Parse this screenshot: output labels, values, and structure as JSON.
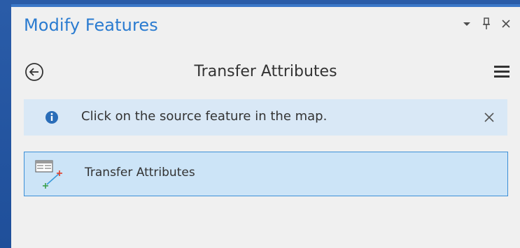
{
  "pane": {
    "title": "Modify Features",
    "controls": {
      "dropdown_icon": "chevron-down-icon",
      "pin_icon": "pin-icon",
      "close_icon": "close-icon"
    }
  },
  "header": {
    "title": "Transfer Attributes",
    "back_icon": "back-arrow-icon",
    "menu_icon": "hamburger-menu-icon"
  },
  "info": {
    "message": "Click on the source feature in the map.",
    "icon": "info-icon",
    "dismiss_icon": "close-icon"
  },
  "tools": [
    {
      "label": "Transfer Attributes",
      "icon": "transfer-attributes-icon",
      "selected": true
    }
  ],
  "colors": {
    "accent": "#2a7bd0",
    "pane_border": "#3c78c8",
    "info_bg": "#d9e8f6",
    "selected_bg": "#cce4f7",
    "selected_border": "#3c8fd6",
    "outer_bg": "#1f4f9a"
  }
}
